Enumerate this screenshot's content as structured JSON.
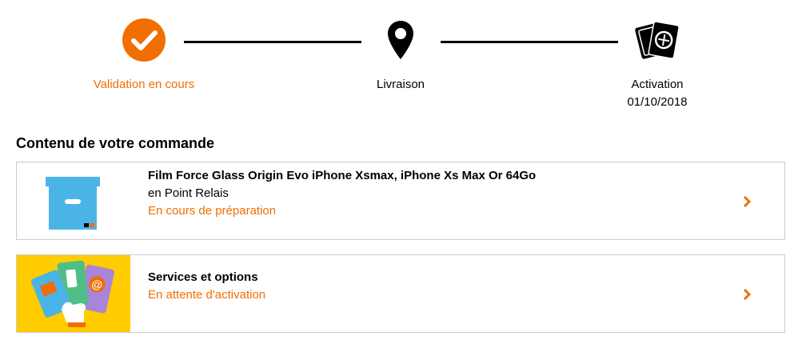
{
  "stepper": {
    "steps": [
      {
        "label": "Validation en cours",
        "state": "active",
        "icon": "check-circle-icon"
      },
      {
        "label": "Livraison",
        "state": "pending",
        "icon": "location-pin-icon"
      },
      {
        "label": "Activation",
        "date": "01/10/2018",
        "state": "pending",
        "icon": "sim-cards-icon"
      }
    ]
  },
  "order": {
    "section_title": "Contenu de votre commande",
    "items": [
      {
        "title": "Film Force Glass Origin Evo iPhone Xsmax, iPhone Xs Max Or 64Go",
        "subtitle": "en Point Relais",
        "status": "En cours de préparation",
        "icon": "package-box-icon"
      },
      {
        "title": "Services et options",
        "status": "En attente d'activation",
        "icon": "service-cards-icon"
      }
    ]
  },
  "colors": {
    "accent": "#f16e00",
    "box_blue": "#4bb4e6",
    "services_yellow": "#ffcc00",
    "card_border": "#cccccc"
  }
}
